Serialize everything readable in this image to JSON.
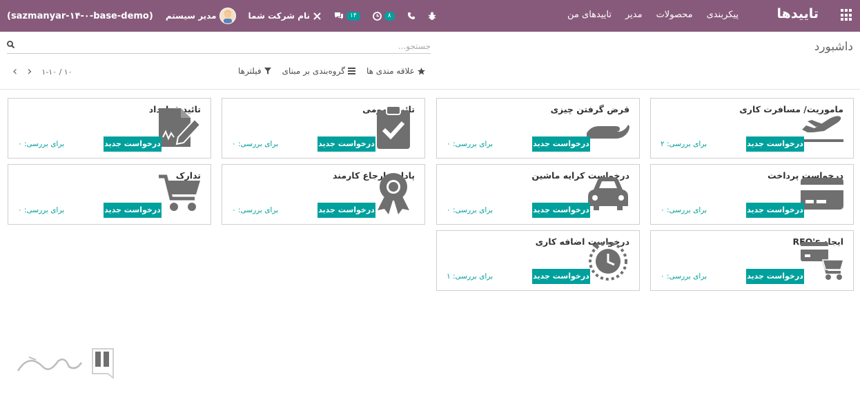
{
  "navbar": {
    "brand": "تاییدها",
    "menu": [
      "تاییدهای من",
      "مدیر",
      "محصولات",
      "پیکربندی"
    ],
    "company": "نام شرکت شما",
    "chat_count": "۱۴",
    "activity_count": "۸",
    "user": "مدیر سیستم",
    "database": "(sazmanyar-۱۴-۰-base-demo)"
  },
  "control_panel": {
    "title": "داشبورد",
    "search_placeholder": "جستجو...",
    "filters_label": "فیلترها",
    "group_by_label": "گروه‌بندی بر مبنای",
    "favorites_label": "علاقه مندی ها",
    "pager": "۱-۱۰ / ۱۰"
  },
  "cards": [
    {
      "title": "ماموریت/ مسافرت کاری",
      "button": "درخواست جدید",
      "review": "برای بررسی: ۲",
      "icon": "plane-icon"
    },
    {
      "title": "قرض گرفتن چیزی",
      "button": "درخواست جدید",
      "review": "برای بررسی: ۰",
      "icon": "hand-icon"
    },
    {
      "title": "تائید عمومی",
      "button": "درخواست جدید",
      "review": "برای بررسی: ۰",
      "icon": "clipboard-check-icon"
    },
    {
      "title": "تائید قرارداد",
      "button": "درخواست جدید",
      "review": "برای بررسی: ۰",
      "icon": "contract-sign-icon"
    },
    {
      "title": "درخواست پرداخت",
      "button": "درخواست جدید",
      "review": "برای بررسی: ۰",
      "icon": "credit-card-icon"
    },
    {
      "title": "درخواست کرایه ماشین",
      "button": "درخواست جدید",
      "review": "برای بررسی: ۰",
      "icon": "car-icon"
    },
    {
      "title": "پاداش ارجاع کارمند",
      "button": "درخواست جدید",
      "review": "برای بررسی: ۰",
      "icon": "award-icon"
    },
    {
      "title": "تدارک",
      "button": "درخواست جدید",
      "review": "برای بررسی: ۰",
      "icon": "cart-icon"
    },
    {
      "title": "ایجاد RFQ's",
      "button": "درخواست جدید",
      "review": "برای بررسی: ۰",
      "icon": "rfq-cart-icon"
    },
    {
      "title": "درخواست اضافه کاری",
      "button": "درخواست جدید",
      "review": "برای بررسی: ۱",
      "icon": "clock-history-icon"
    }
  ],
  "colors": {
    "navbar": "#875a7b",
    "primary": "#00a09d",
    "icon": "#6f6f6f"
  }
}
